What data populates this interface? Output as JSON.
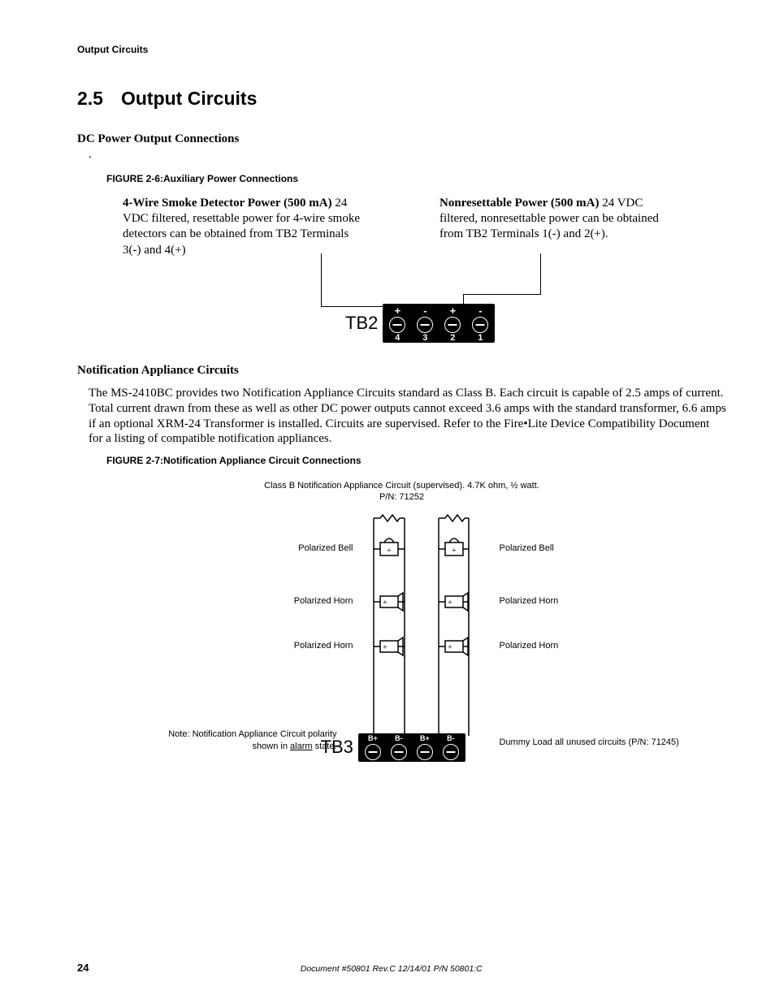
{
  "header": {
    "running": "Output Circuits"
  },
  "section": {
    "number": "2.5",
    "title": "Output Circuits"
  },
  "dc_power": {
    "heading": "DC Power Output Connections",
    "dot": ".",
    "figure_label": "FIGURE 2-6:",
    "figure_title": "Auxiliary Power Connections",
    "left": {
      "lead": "4-Wire Smoke Detector Power (500 mA)",
      "body": "  24 VDC filtered, resettable power for 4-wire smoke detectors can be obtained from TB2 Terminals 3(-) and 4(+)"
    },
    "right": {
      "lead": "Nonresettable Power (500 mA)",
      "body": "  24 VDC filtered, nonresettable power can be obtained from TB2 Terminals 1(-) and 2(+)."
    },
    "tb2": {
      "label": "TB2",
      "terminals": [
        {
          "sign": "+",
          "num": "4"
        },
        {
          "sign": "-",
          "num": "3"
        },
        {
          "sign": "+",
          "num": "2"
        },
        {
          "sign": "-",
          "num": "1"
        }
      ]
    }
  },
  "nac": {
    "heading": "Notification Appliance Circuits",
    "paragraph": "The MS-2410BC provides two Notification Appliance Circuits standard as Class B.  Each circuit is capable of 2.5 amps of current.  Total current drawn from these as well as other DC power outputs cannot exceed 3.6 amps with the standard transformer, 6.6 amps if an optional XRM-24 Transformer is installed.  Circuits are supervised.  Refer to the Fire•Lite Device Compatibility Document for a listing of compatible notification appliances.",
    "figure_label": "FIGURE 2-7:",
    "figure_title": "Notification Appliance Circuit Connections",
    "top_caption_line1": "Class B Notification Appliance Circuit (supervised).  4.7K ohm, ½ watt.",
    "top_caption_line2": "P/N: 71252",
    "rows": [
      {
        "left": "Polarized Bell",
        "right": "Polarized Bell"
      },
      {
        "left": "Polarized Horn",
        "right": "Polarized Horn"
      },
      {
        "left": "Polarized Horn",
        "right": "Polarized Horn"
      }
    ],
    "note_left_l1": "Note: Notification Appliance Circuit polarity",
    "note_left_l2_a": "shown in ",
    "note_left_l2_b": "alarm",
    "note_left_l2_c": " state.",
    "note_right": "Dummy Load all unused circuits (P/N: 71245)",
    "tb3": {
      "label": "TB3",
      "terminals": [
        "B+",
        "B-",
        "B+",
        "B-"
      ]
    }
  },
  "footer": {
    "page": "24",
    "doc": "Document #50801    Rev.C    12/14/01    P/N 50801:C"
  }
}
